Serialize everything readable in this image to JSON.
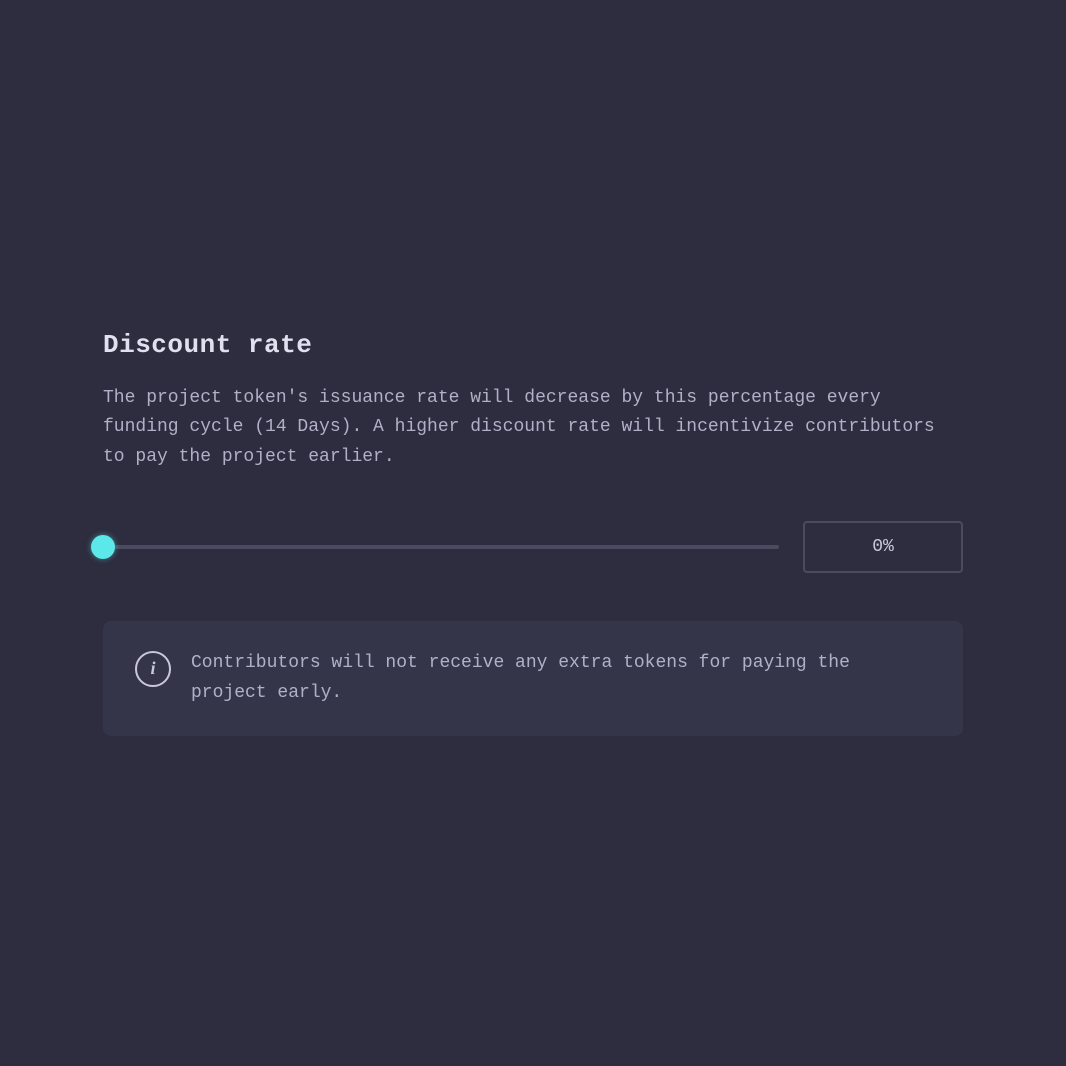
{
  "page": {
    "background": "#2d2d3f",
    "title": "Discount rate",
    "description": "The project token's issuance rate will decrease by this percentage every funding cycle (14 Days). A higher discount rate will incentivize contributors to pay the project earlier.",
    "slider": {
      "min": 0,
      "max": 100,
      "value": 0,
      "step": 1
    },
    "value_display": "0%",
    "info_icon_label": "i",
    "info_message": "Contributors will not receive any extra tokens for paying the project early."
  }
}
